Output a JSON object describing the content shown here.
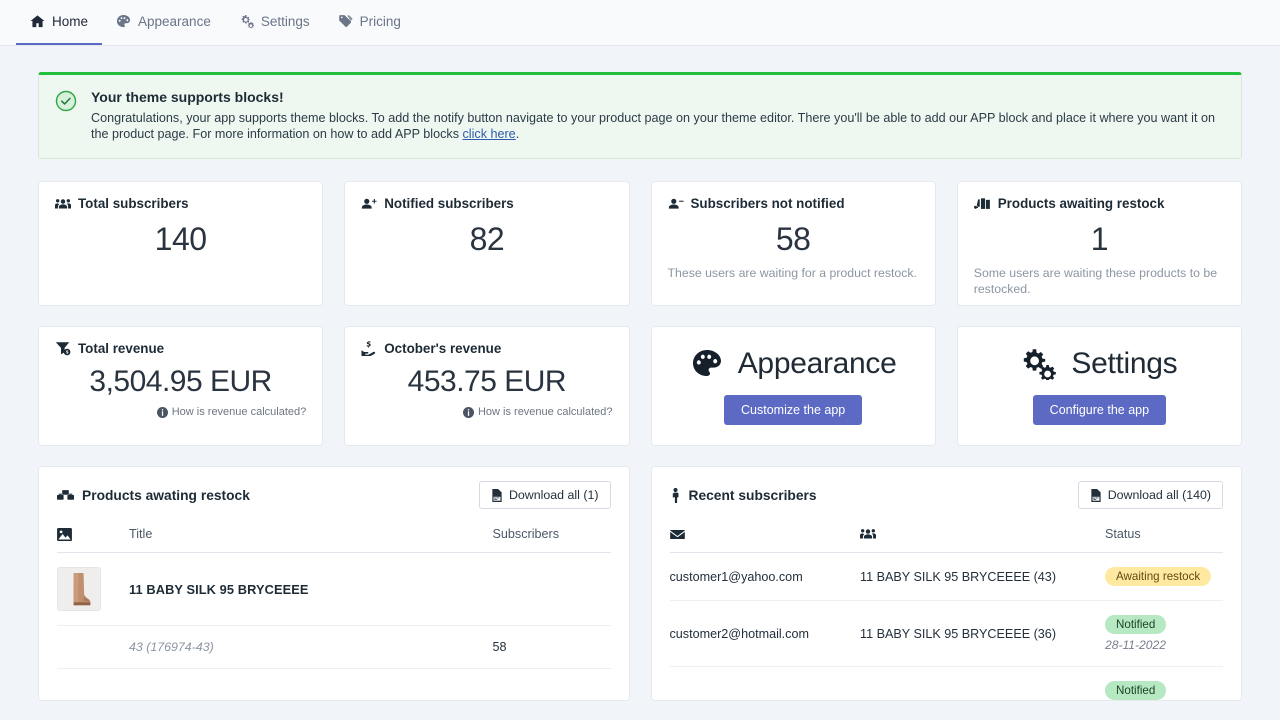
{
  "nav": {
    "items": [
      {
        "label": "Home",
        "icon": "home-icon",
        "active": true
      },
      {
        "label": "Appearance",
        "icon": "palette-icon",
        "active": false
      },
      {
        "label": "Settings",
        "icon": "gears-icon",
        "active": false
      },
      {
        "label": "Pricing",
        "icon": "tag-icon",
        "active": false
      }
    ]
  },
  "banner": {
    "icon": "check-circle-icon",
    "title": "Your theme supports blocks!",
    "text_part1": "Congratulations, your app supports theme blocks. To add the notify button navigate to your product page on your theme editor. There you'll be able to add our APP block and place it where you want it on the product page. For more information on how to add APP blocks ",
    "link_text": "click here",
    "text_part2": ".",
    "accent_color": "#22c03c",
    "background_color": "#eef8f0"
  },
  "stats": [
    {
      "icon": "users-icon",
      "label": "Total subscribers",
      "value": "140",
      "note": ""
    },
    {
      "icon": "user-plus-icon",
      "label": "Notified subscribers",
      "value": "82",
      "note": ""
    },
    {
      "icon": "user-minus-icon",
      "label": "Subscribers not notified",
      "value": "58",
      "note": "These users are waiting for a product restock."
    },
    {
      "icon": "truck-loading-icon",
      "label": "Products awaiting restock",
      "value": "1",
      "note": "Some users are waiting these products to be restocked."
    }
  ],
  "revenue": [
    {
      "icon": "funnel-dollar-icon",
      "label": "Total revenue",
      "value": "3,504.95 EUR",
      "link": "How is revenue calculated?",
      "link_icon": "info-circle-icon"
    },
    {
      "icon": "hand-holding-dollar-icon",
      "label": "October's revenue",
      "value": "453.75 EUR",
      "link": "How is revenue calculated?",
      "link_icon": "info-circle-icon"
    }
  ],
  "actions": [
    {
      "icon": "palette-icon",
      "title": "Appearance",
      "button": "Customize the app",
      "button_color": "#5c6ac4"
    },
    {
      "icon": "gears-icon",
      "title": "Settings",
      "button": "Configure the app",
      "button_color": "#5c6ac4"
    }
  ],
  "products_panel": {
    "icon": "boxes-icon",
    "title": "Products awating restock",
    "download_label": "Download all (1)",
    "download_icon": "file-download-icon",
    "columns": [
      {
        "type": "icon",
        "icon": "image-icon",
        "label": ""
      },
      {
        "type": "text",
        "label": "Title"
      },
      {
        "type": "text",
        "label": "Subscribers"
      }
    ],
    "rows": [
      {
        "thumb": "boot-image",
        "title": "11 BABY SILK 95 BRYCEEEE",
        "subscribers": ""
      },
      {
        "thumb": "",
        "title": "43 (176974-43)",
        "title_style": "variant",
        "subscribers": "58"
      }
    ]
  },
  "subscribers_panel": {
    "icon": "person-icon",
    "title": "Recent subscribers",
    "download_label": "Download all (140)",
    "download_icon": "file-download-icon",
    "columns": [
      {
        "type": "icon",
        "icon": "envelope-icon",
        "label": ""
      },
      {
        "type": "icon",
        "icon": "users-icon",
        "label": ""
      },
      {
        "type": "text",
        "label": "Status"
      }
    ],
    "rows": [
      {
        "email": "customer1@yahoo.com",
        "product": "11 BABY SILK 95 BRYCEEEE (43)",
        "status": "Awaiting restock",
        "status_type": "warning",
        "date": ""
      },
      {
        "email": "customer2@hotmail.com",
        "product": "11 BABY SILK 95 BRYCEEEE (36)",
        "status": "Notified",
        "status_type": "success",
        "date": "28-11-2022"
      },
      {
        "email": "",
        "product": "",
        "status": "Notified",
        "status_type": "success",
        "date": ""
      }
    ]
  },
  "colors": {
    "page_background": "#f1f4f8",
    "card_background": "#ffffff",
    "accent": "#5c6ac4",
    "success": "#22c03c",
    "badge_warning_bg": "#ffe9a0",
    "badge_success_bg": "#b6e8c2"
  }
}
